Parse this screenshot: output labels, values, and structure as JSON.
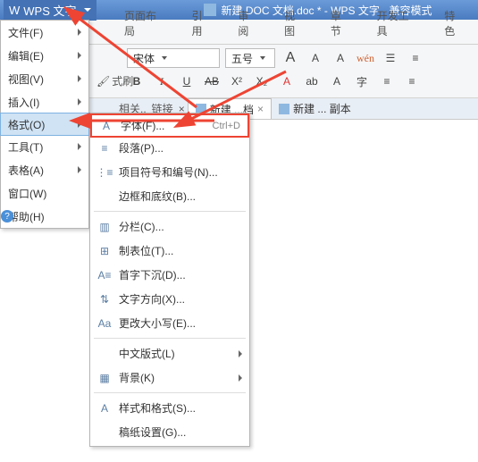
{
  "titlebar": {
    "app_label": "WPS 文字",
    "doc_title": "新建 DOC 文档.doc * - WPS 文字 - 兼容模式"
  },
  "ribbon_tabs": [
    "页面布局",
    "引用",
    "审阅",
    "视图",
    "章节",
    "开发工具",
    "特色"
  ],
  "toolbar": {
    "format_painter": "式刷",
    "font_name": "宋体",
    "font_size": "五号",
    "btn_A_grow": "A",
    "btn_A_shrink": "A",
    "btn_clear": "A",
    "btn_wen": "wén",
    "btn_bold": "B",
    "btn_italic": "I",
    "btn_underline": "U",
    "btn_strike": "AB",
    "btn_super": "X²",
    "btn_sub": "X₂",
    "btn_fontA": "A"
  },
  "doc_tabs": {
    "frag1": "相关..",
    "frag2": "链接",
    "active": "新建 ...档",
    "other": "新建 ... 副本"
  },
  "main_menu": {
    "file": "文件(F)",
    "edit": "编辑(E)",
    "view": "视图(V)",
    "insert": "插入(I)",
    "format": "格式(O)",
    "tools": "工具(T)",
    "table": "表格(A)",
    "window": "窗口(W)",
    "help": "帮助(H)"
  },
  "sub_menu": {
    "font": "字体(F)...",
    "font_shortcut": "Ctrl+D",
    "paragraph": "段落(P)...",
    "bullets": "项目符号和编号(N)...",
    "borders": "边框和底纹(B)...",
    "columns": "分栏(C)...",
    "tabs": "制表位(T)...",
    "dropcap": "首字下沉(D)...",
    "textdir": "文字方向(X)...",
    "changecase": "更改大小写(E)...",
    "chinese": "中文版式(L)",
    "background": "背景(K)",
    "styles": "样式和格式(S)...",
    "grid": "稿纸设置(G)..."
  }
}
